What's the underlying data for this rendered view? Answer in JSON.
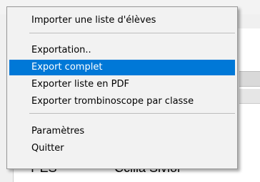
{
  "menu": {
    "items": [
      {
        "label": "Importer une liste d'élèves"
      },
      {
        "label": "Exportation.."
      },
      {
        "label": "Export complet"
      },
      {
        "label": "Exporter liste en PDF"
      },
      {
        "label": "Exporter trombinoscope par classe"
      },
      {
        "label": "Paramètres"
      },
      {
        "label": "Quitter"
      }
    ],
    "selected_label": "Export complet"
  },
  "background": {
    "row_col1": "T ES",
    "row_col2": "Ccilia Sivior"
  },
  "colors": {
    "selection": "#0078d7",
    "menu_bg": "#f2f2f2"
  }
}
